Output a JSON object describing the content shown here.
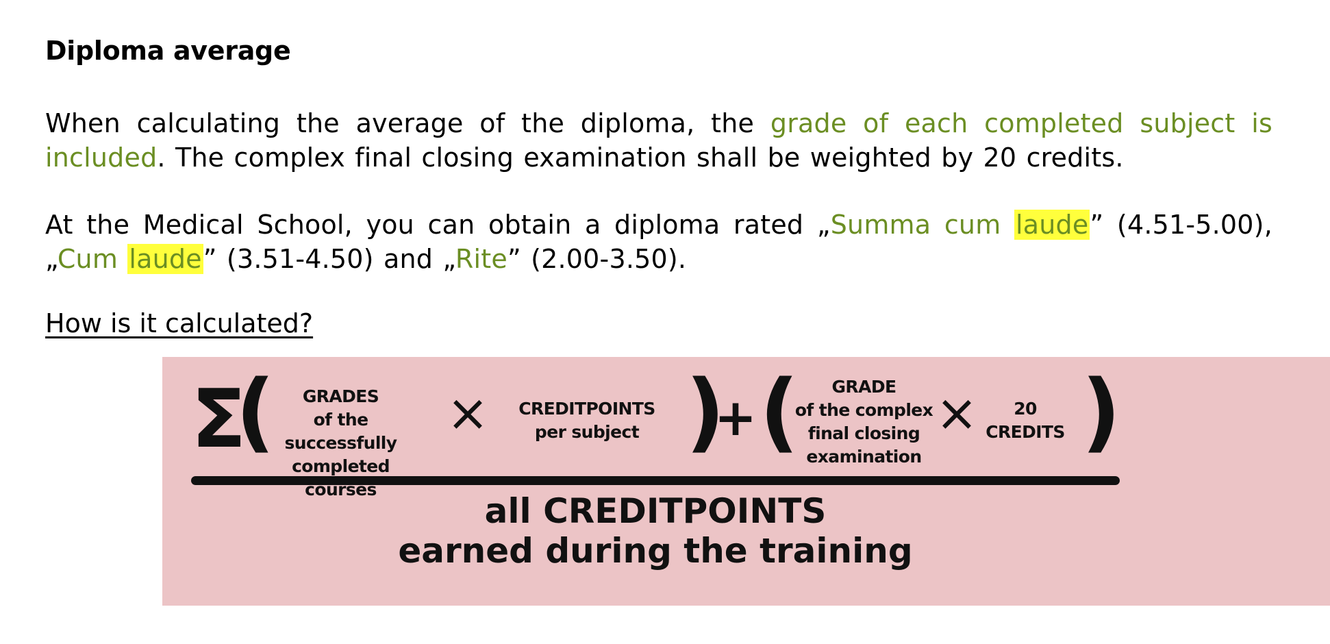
{
  "heading": "Diploma average",
  "paragraph1": {
    "before": "When calculating the average of the diploma, the ",
    "green": "grade of each completed subject is included",
    "after": ". The complex final closing examination shall be weighted by 20 credits."
  },
  "paragraph2": {
    "t1": "At the Medical School, you can obtain a diploma rated „",
    "summa": "Summa cum ",
    "laude1": "laude",
    "t2": "” (4.51-5.00), „",
    "cum": "Cum ",
    "laude2": "laude",
    "t3": "” (3.51-4.50) and „",
    "rite": "Rite",
    "t4": "” (2.00-3.50)."
  },
  "subheading": "How is it calculated?",
  "formula": {
    "sigma": "Σ",
    "open_paren": "(",
    "close_paren": ")",
    "times": "×",
    "plus": "+",
    "term1": [
      "GRADES",
      "of the successfully",
      "completed courses"
    ],
    "term2": [
      "CREDITPOINTS",
      "per subject"
    ],
    "term3": [
      "GRADE",
      "of the complex",
      "final closing",
      "examination"
    ],
    "term4": [
      "20",
      "CREDITS"
    ],
    "denominator": [
      "all CREDITPOINTS",
      "earned during the training"
    ]
  },
  "colors": {
    "accent_green": "#6b8e23",
    "highlight_yellow": "#ffff3c",
    "formula_background": "#ecc4c6"
  }
}
